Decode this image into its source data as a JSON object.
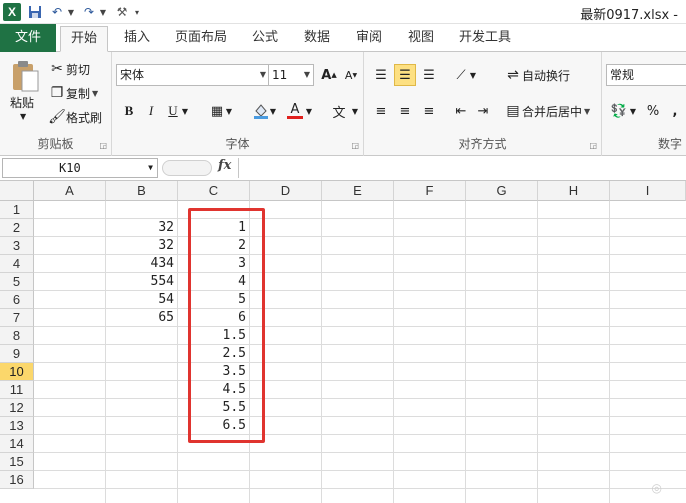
{
  "window": {
    "title": "最新0917.xlsx  -"
  },
  "qat": {
    "logo": "X"
  },
  "tabs": [
    {
      "label": "文件"
    },
    {
      "label": "开始"
    },
    {
      "label": "插入"
    },
    {
      "label": "页面布局"
    },
    {
      "label": "公式"
    },
    {
      "label": "数据"
    },
    {
      "label": "审阅"
    },
    {
      "label": "视图"
    },
    {
      "label": "开发工具"
    }
  ],
  "ribbon": {
    "clipboard": {
      "label": "剪贴板",
      "paste": "粘贴",
      "cut": "剪切",
      "copy": "复制",
      "format_painter": "格式刷"
    },
    "font": {
      "label": "字体",
      "font_name": "宋体",
      "font_size": "11",
      "bold": "B",
      "italic": "I",
      "underline": "U",
      "grow": "A",
      "shrink": "A",
      "font_color": "A",
      "phonetic": "文"
    },
    "alignment": {
      "label": "对齐方式",
      "wrap_text": "自动换行",
      "merge_center": "合并后居中"
    },
    "number": {
      "label": "数字",
      "format": "常规",
      "percent": "%",
      "comma": ","
    }
  },
  "formula_bar": {
    "name_box": "K10",
    "fx": "fx",
    "value": ""
  },
  "grid": {
    "columns": [
      "A",
      "B",
      "C",
      "D",
      "E",
      "F",
      "G",
      "H",
      "I"
    ],
    "rows": [
      "1",
      "2",
      "3",
      "4",
      "5",
      "6",
      "7",
      "8",
      "9",
      "10",
      "11",
      "12",
      "13",
      "14",
      "15",
      "16"
    ],
    "selected_row": "10",
    "column_b": [
      "",
      "32",
      "32",
      "434",
      "554",
      "54",
      "65",
      "",
      "",
      "",
      "",
      "",
      "",
      "",
      "",
      ""
    ],
    "column_c": [
      "",
      "1",
      "2",
      "3",
      "4",
      "5",
      "6",
      "1.5",
      "2.5",
      "3.5",
      "4.5",
      "5.5",
      "6.5",
      "",
      "",
      ""
    ]
  },
  "colors": {
    "accent": "#1f7244",
    "highlight_box": "#e0342f",
    "selected_row_header": "#fbd76b"
  }
}
